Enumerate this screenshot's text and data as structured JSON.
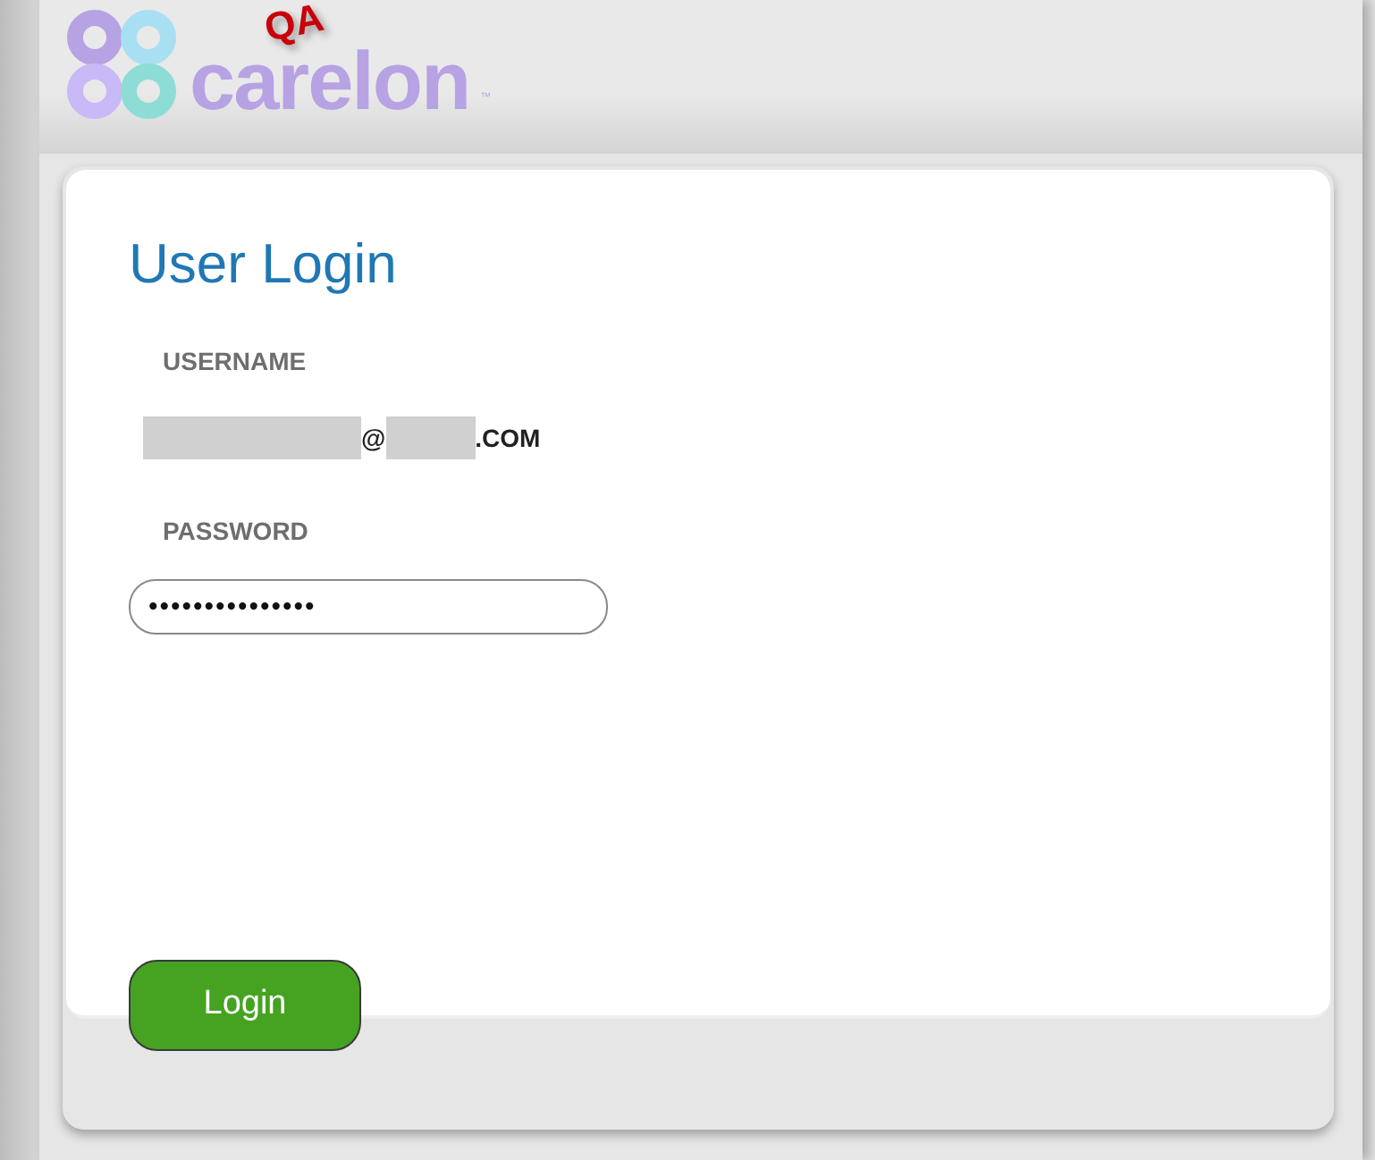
{
  "logo": {
    "text": "carelon",
    "trademark": "™",
    "badge": "QA"
  },
  "login": {
    "title": "User Login",
    "username": {
      "label": "USERNAME",
      "at": "@",
      "suffix": ".COM"
    },
    "password": {
      "label": "PASSWORD",
      "value": "•••••••••••••••"
    },
    "button": "Login"
  }
}
